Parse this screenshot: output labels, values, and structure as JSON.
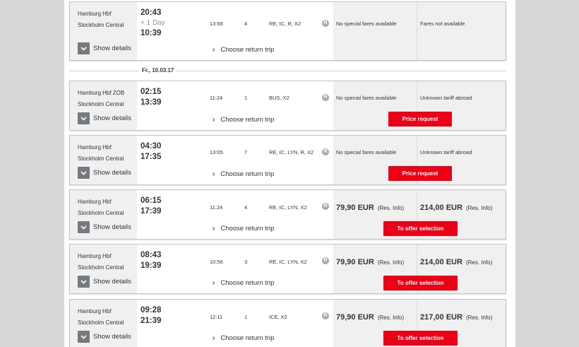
{
  "show_details_label": "Show details",
  "choose_return_label": "Choose return trip",
  "date_separator": "Fr., 10.03.17",
  "rail_badge": "R",
  "accent_color": "#ec0016",
  "connections": [
    {
      "from": "Hamburg Hbf",
      "to": "Stockholm Central",
      "dep": "20:43",
      "arr": "10:39",
      "day_note": "+ 1 Day",
      "duration": "13:56",
      "changes": "4",
      "products": "RE, IC, R, X2",
      "fare1": "No special fares available",
      "fare2": "Fares not available"
    },
    {
      "from": "Hamburg Hbf ZOB",
      "to": "Stockholm Central",
      "dep": "02:15",
      "arr": "13:39",
      "duration": "11:24",
      "changes": "1",
      "products": "BUS, X2",
      "fare1": "No special fares available",
      "fare2": "Unknown tariff abroad",
      "button": "Price request"
    },
    {
      "from": "Hamburg Hbf",
      "to": "Stockholm Central",
      "dep": "04:30",
      "arr": "17:35",
      "duration": "13:05",
      "changes": "7",
      "products": "RE, IC, LYN, R, X2",
      "fare1": "No special fares available",
      "fare2": "Unknown tariff abroad",
      "button": "Price request"
    },
    {
      "from": "Hamburg Hbf",
      "to": "Stockholm Central",
      "dep": "06:15",
      "arr": "17:39",
      "duration": "11:24",
      "changes": "4",
      "products": "RE, IC, LYN, X2",
      "price1": "79,90 EUR",
      "price2": "214,00 EUR",
      "res_info": "(Res. Info)",
      "button": "To offer selection"
    },
    {
      "from": "Hamburg Hbf",
      "to": "Stockholm Central",
      "dep": "08:43",
      "arr": "19:39",
      "duration": "10:56",
      "changes": "3",
      "products": "RE, IC, LYN, X2",
      "price1": "79,90 EUR",
      "price2": "214,00 EUR",
      "res_info": "(Res. Info)",
      "button": "To offer selection"
    },
    {
      "from": "Hamburg Hbf",
      "to": "Stockholm Central",
      "dep": "09:28",
      "arr": "21:39",
      "duration": "12:11",
      "changes": "1",
      "products": "ICE, X2",
      "price1": "79,90 EUR",
      "price2": "217,00 EUR",
      "res_info": "(Res. Info)",
      "button": "To offer selection"
    }
  ]
}
